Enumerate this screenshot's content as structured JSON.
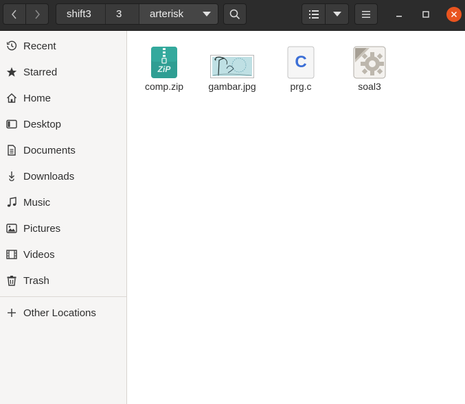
{
  "header": {
    "breadcrumbs": [
      "shift3",
      "3",
      "arterisk"
    ]
  },
  "sidebar": {
    "items": [
      {
        "label": "Recent",
        "icon": "clock-icon"
      },
      {
        "label": "Starred",
        "icon": "star-icon"
      },
      {
        "label": "Home",
        "icon": "home-icon"
      },
      {
        "label": "Desktop",
        "icon": "desktop-icon"
      },
      {
        "label": "Documents",
        "icon": "document-icon"
      },
      {
        "label": "Downloads",
        "icon": "download-icon"
      },
      {
        "label": "Music",
        "icon": "music-icon"
      },
      {
        "label": "Pictures",
        "icon": "picture-icon"
      },
      {
        "label": "Videos",
        "icon": "video-icon"
      },
      {
        "label": "Trash",
        "icon": "trash-icon"
      }
    ],
    "other_locations": {
      "label": "Other Locations",
      "icon": "plus-icon"
    }
  },
  "files": [
    {
      "name": "comp.zip",
      "icon": "zip-archive-icon",
      "badge": "ZiP"
    },
    {
      "name": "gambar.jpg",
      "icon": "image-thumbnail-icon"
    },
    {
      "name": "prg.c",
      "icon": "c-source-icon",
      "badge": "C"
    },
    {
      "name": "soal3",
      "icon": "executable-gear-icon"
    }
  ],
  "colors": {
    "headerbar": "#2c2c2c",
    "sidebar": "#f6f5f4",
    "close_button": "#e9541f",
    "zip_icon": "#2f9e93",
    "c_letter": "#3c6fd6"
  }
}
